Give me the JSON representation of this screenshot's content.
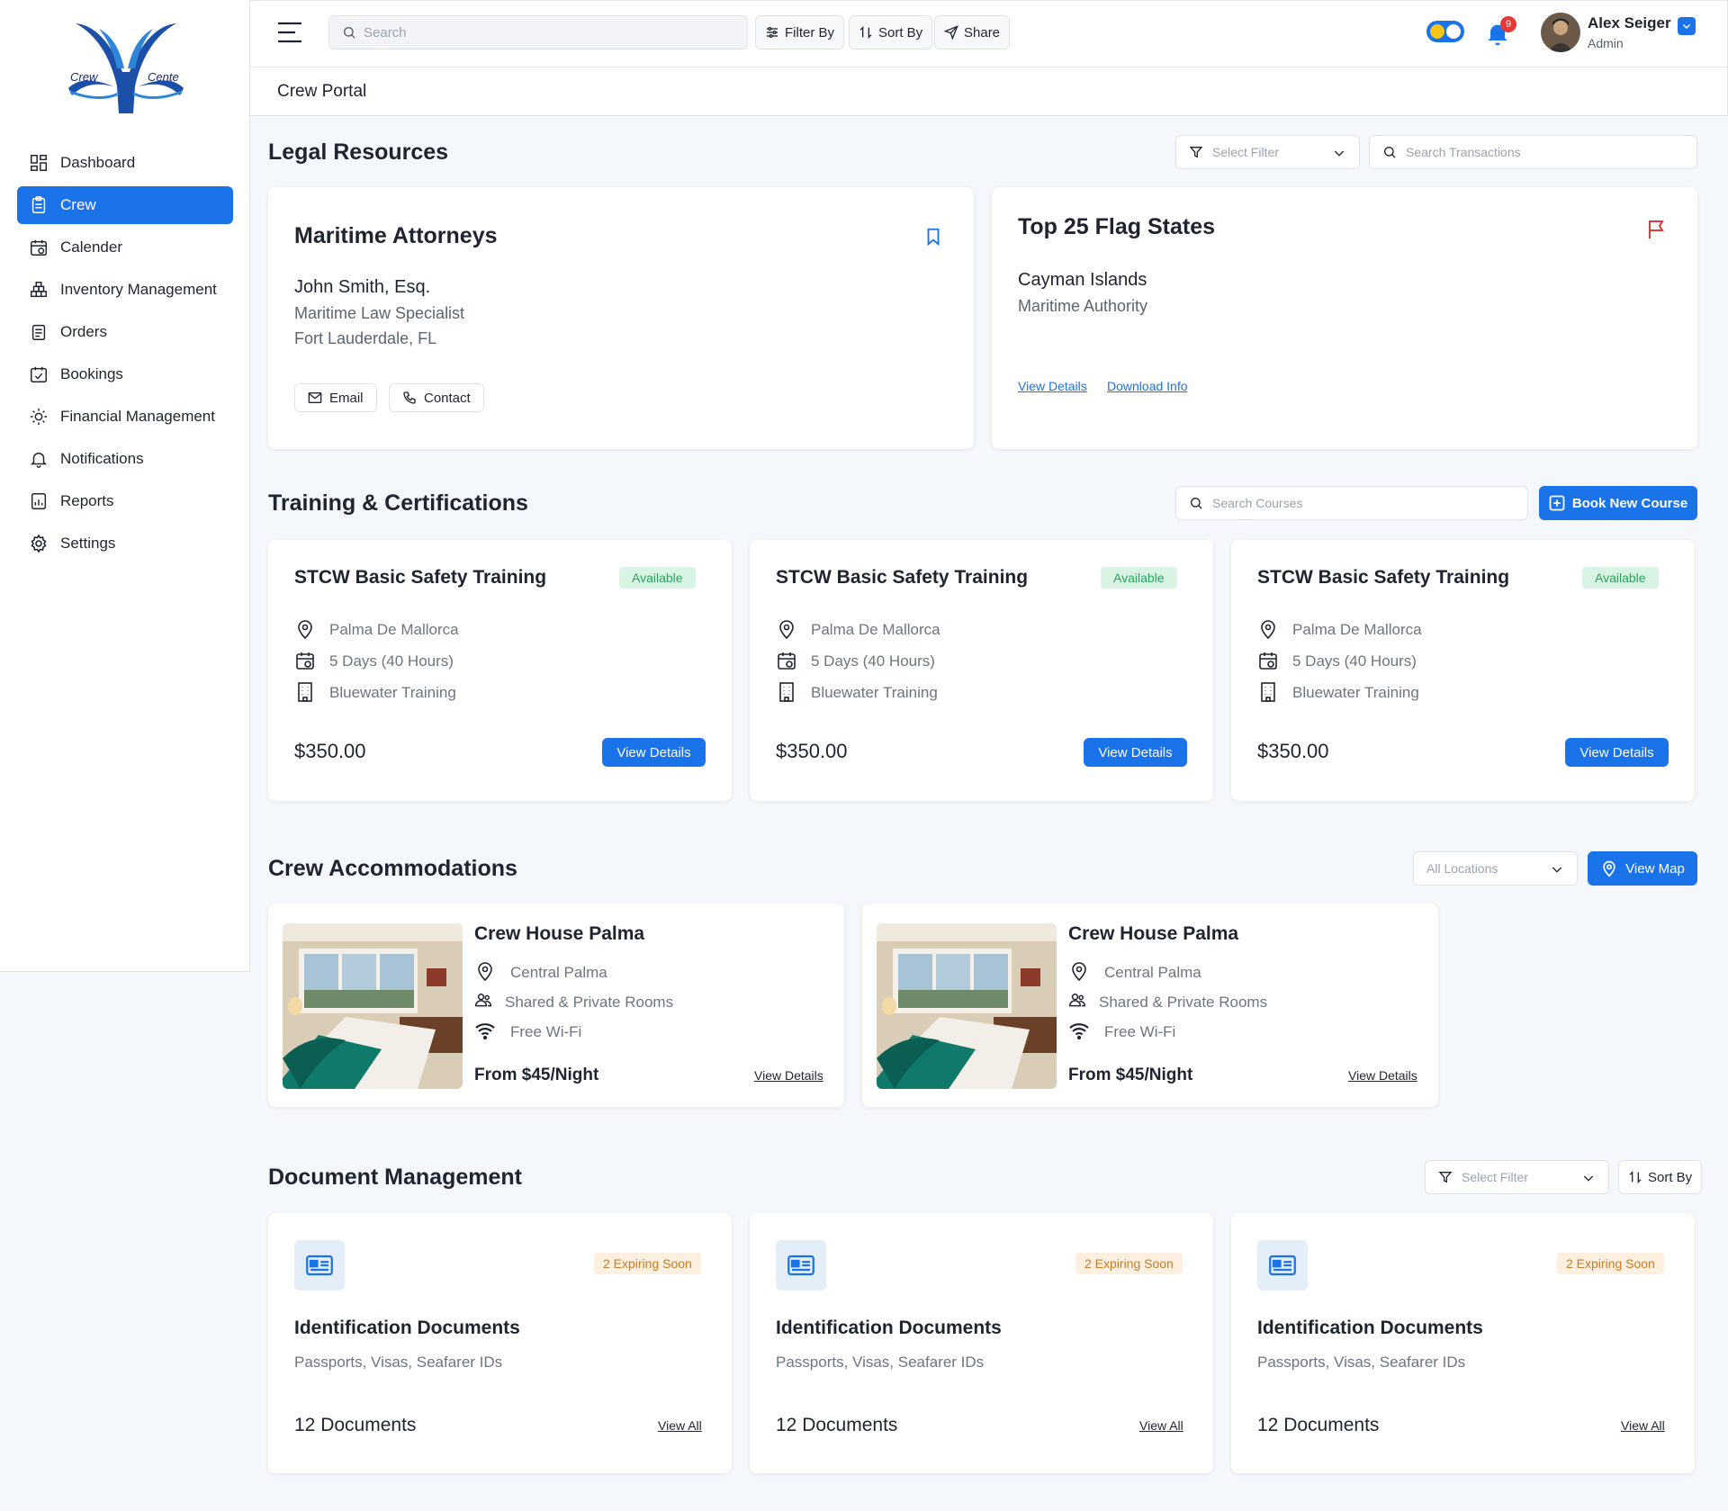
{
  "brand": {
    "logo_text_left": "Crew",
    "logo_text_right": "Cente"
  },
  "sidebar": {
    "items": [
      {
        "label": "Dashboard",
        "icon": "dashboard-icon"
      },
      {
        "label": "Crew",
        "icon": "clipboard-icon",
        "active": true
      },
      {
        "label": "Calender",
        "icon": "calendar-icon"
      },
      {
        "label": "Inventory Management",
        "icon": "warehouse-icon"
      },
      {
        "label": "Orders",
        "icon": "orders-icon"
      },
      {
        "label": "Bookings",
        "icon": "bookings-icon"
      },
      {
        "label": "Financial Management",
        "icon": "finance-gear-icon"
      },
      {
        "label": "Notifications",
        "icon": "bell-icon"
      },
      {
        "label": "Reports",
        "icon": "reports-icon"
      },
      {
        "label": "Settings",
        "icon": "settings-icon"
      }
    ]
  },
  "topbar": {
    "search_placeholder": "Search",
    "filter_label": "Filter By",
    "sort_label": "Sort By",
    "share_label": "Share",
    "notification_count": "9",
    "user_name": "Alex Seiger",
    "user_role": "Admin"
  },
  "breadcrumb": "Crew Portal",
  "legal": {
    "title": "Legal Resources",
    "filter_placeholder": "Select Filter",
    "search_placeholder": "Search Transactions",
    "attorneys": {
      "title": "Maritime Attorneys",
      "name": "John Smith, Esq.",
      "specialty": "Maritime Law Specialist",
      "location": "Fort Lauderdale, FL",
      "email_label": "Email",
      "contact_label": "Contact"
    },
    "flags": {
      "title": "Top 25 Flag States",
      "state": "Cayman Islands",
      "authority": "Maritime Authority",
      "view_label": "View Details",
      "download_label": "Download Info"
    }
  },
  "training": {
    "title": "Training & Certifications",
    "search_placeholder": "Search Courses",
    "book_label": "Book New Course",
    "courses": [
      {
        "title": "STCW Basic Safety Training",
        "status": "Available",
        "location": "Palma De Mallorca",
        "duration": "5 Days (40 Hours)",
        "provider": "Bluewater Training",
        "price": "$350.00",
        "button": "View Details"
      },
      {
        "title": "STCW Basic Safety Training",
        "status": "Available",
        "location": "Palma De Mallorca",
        "duration": "5 Days (40 Hours)",
        "provider": "Bluewater Training",
        "price": "$350.00",
        "button": "View Details"
      },
      {
        "title": "STCW Basic Safety Training",
        "status": "Available",
        "location": "Palma De Mallorca",
        "duration": "5 Days (40 Hours)",
        "provider": "Bluewater Training",
        "price": "$350.00",
        "button": "View Details"
      }
    ]
  },
  "accommodations": {
    "title": "Crew Accommodations",
    "location_filter": "All Locations",
    "map_label": "View Map",
    "items": [
      {
        "name": "Crew House Palma",
        "location": "Central Palma",
        "rooms": "Shared & Private Rooms",
        "wifi": "Free Wi-Fi",
        "price": "From $45/Night",
        "link": "View Details"
      },
      {
        "name": "Crew House Palma",
        "location": "Central Palma",
        "rooms": "Shared & Private Rooms",
        "wifi": "Free Wi-Fi",
        "price": "From $45/Night",
        "link": "View Details"
      }
    ]
  },
  "documents": {
    "title": "Document Management",
    "filter_placeholder": "Select Filter",
    "sort_label": "Sort By",
    "items": [
      {
        "badge": "2 Expiring Soon",
        "title": "Identification Documents",
        "desc": "Passports, Visas, Seafarer IDs",
        "count": "12 Documents",
        "link": "View All"
      },
      {
        "badge": "2 Expiring Soon",
        "title": "Identification Documents",
        "desc": "Passports, Visas, Seafarer IDs",
        "count": "12 Documents",
        "link": "View All"
      },
      {
        "badge": "2 Expiring Soon",
        "title": "Identification Documents",
        "desc": "Passports, Visas, Seafarer IDs",
        "count": "12 Documents",
        "link": "View All"
      }
    ]
  },
  "colors": {
    "accent": "#1a73e8",
    "success": "#25a45f",
    "warning": "#c87b28",
    "flag": "#e53935"
  }
}
